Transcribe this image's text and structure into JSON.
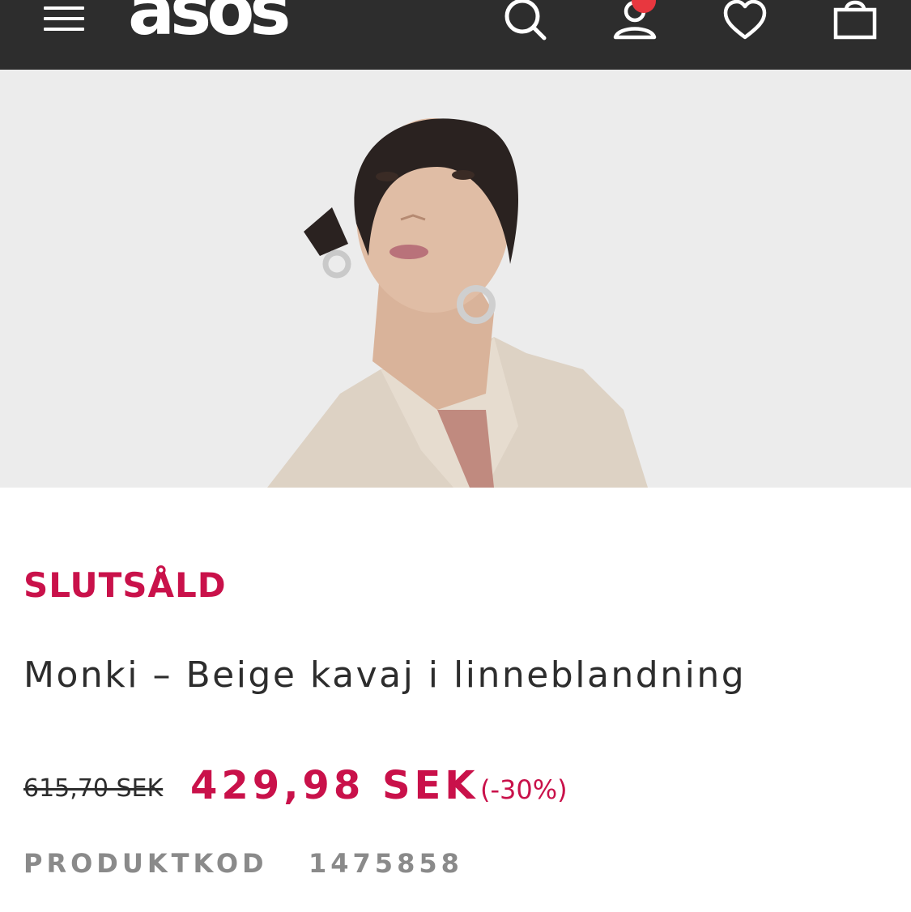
{
  "header": {
    "logo": "asos",
    "icons": [
      "menu-icon",
      "search-icon",
      "account-icon",
      "heart-icon",
      "bag-icon"
    ],
    "background": "#2d2d2d",
    "badge_color": "#e8373f"
  },
  "product": {
    "status": "SLUTSÅLD",
    "title": "Monki – Beige kavaj i linneblandning",
    "old_price": "615,70 SEK",
    "price": "429,98 SEK",
    "discount": "(-30%)",
    "code_label": "PRODUKTKOD",
    "code_value": "1475858",
    "accent_color": "#c9114a"
  }
}
